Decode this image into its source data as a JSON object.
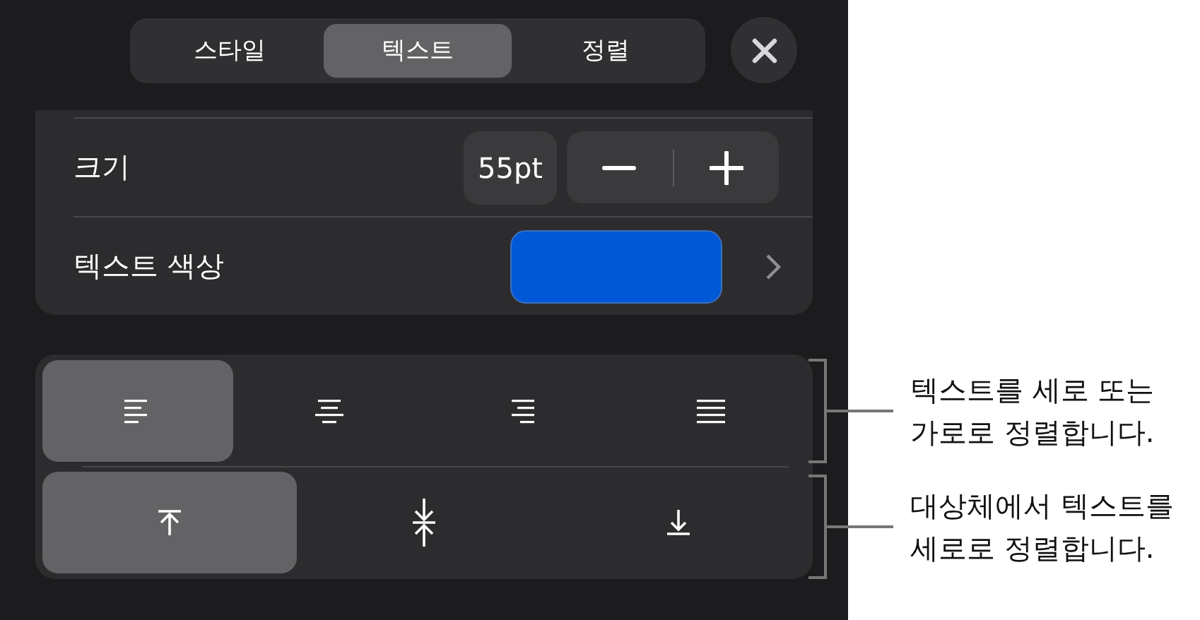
{
  "tabs": [
    {
      "label": "스타일",
      "selected": false
    },
    {
      "label": "텍스트",
      "selected": true
    },
    {
      "label": "정렬",
      "selected": false
    }
  ],
  "size": {
    "label": "크기",
    "value": "55pt"
  },
  "text_color": {
    "label": "텍스트 색상",
    "color": "#0058d6"
  },
  "horizontal_alignment": [
    {
      "kind": "left",
      "selected": true
    },
    {
      "kind": "center",
      "selected": false
    },
    {
      "kind": "right",
      "selected": false
    },
    {
      "kind": "justify",
      "selected": false
    }
  ],
  "vertical_alignment": [
    {
      "kind": "top",
      "selected": true
    },
    {
      "kind": "middle",
      "selected": false
    },
    {
      "kind": "bottom",
      "selected": false
    }
  ],
  "callouts": [
    "텍스트를 세로 또는\n가로로 정렬합니다.",
    "대상체에서 텍스트를\n세로로 정렬합니다."
  ]
}
